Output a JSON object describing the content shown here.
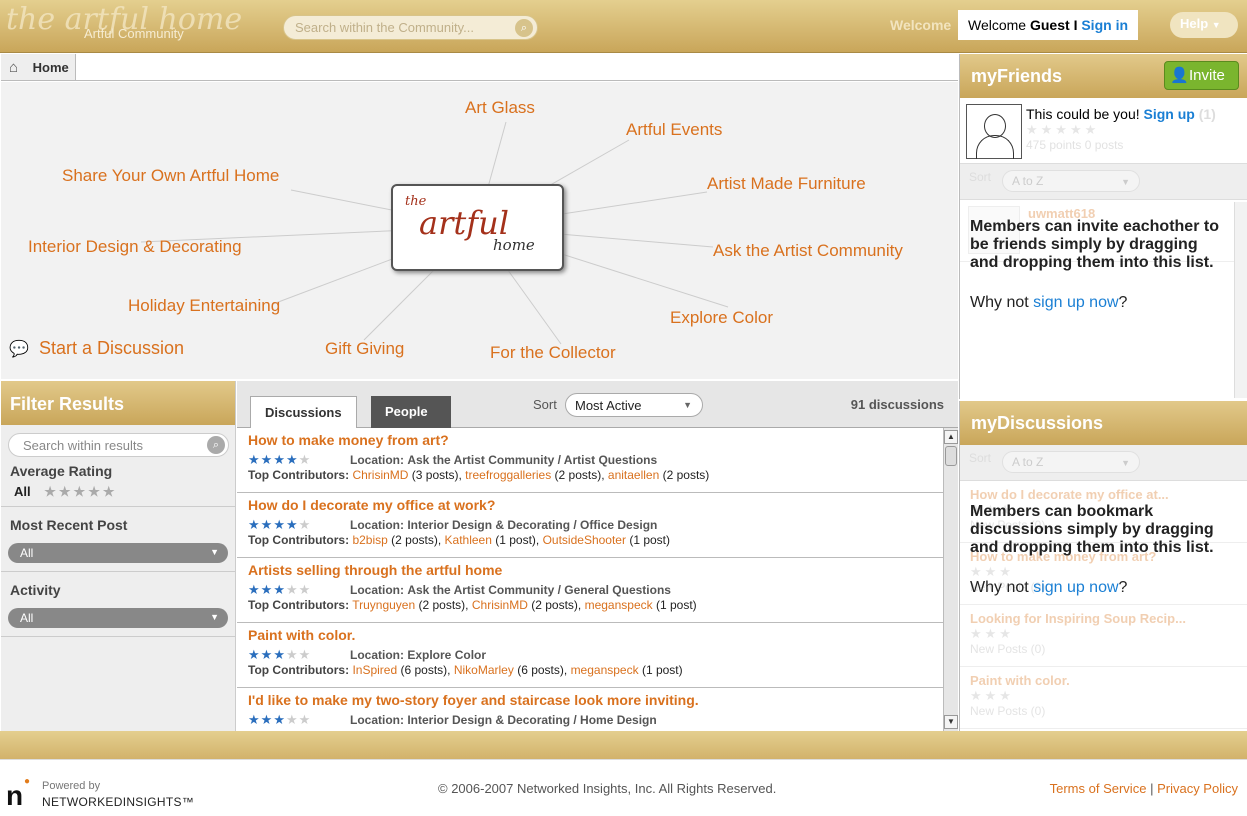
{
  "header": {
    "logo_text": "the artful home",
    "logo_sub": "Artful Community",
    "search_placeholder": "Search within the Community...",
    "welcome_ghost": "Welcome",
    "welcome_prefix": "Welcome",
    "user": "Guest",
    "separator": "I",
    "sign_in": "Sign in",
    "help": "Help"
  },
  "breadcrumb": {
    "home": "Home"
  },
  "map": {
    "center_logo_line1": "the",
    "center_logo_line2": "artful",
    "center_logo_line3": "home",
    "labels": {
      "art_glass": "Art Glass",
      "artful_events": "Artful Events",
      "share": "Share Your Own Artful Home",
      "furniture": "Artist Made Furniture",
      "interior": "Interior Design & Decorating",
      "ask": "Ask the Artist Community",
      "holiday": "Holiday Entertaining",
      "explore": "Explore Color",
      "gift": "Gift Giving",
      "collector": "For the Collector"
    },
    "start_discussion": "Start a Discussion"
  },
  "filter": {
    "title": "Filter Results",
    "search_placeholder": "Search within results",
    "rating_label": "Average Rating",
    "rating_value": "All",
    "recent_label": "Most Recent Post",
    "recent_value": "All",
    "activity_label": "Activity",
    "activity_value": "All"
  },
  "discussions": {
    "tab_discussions": "Discussions",
    "tab_people": "People",
    "sort_label": "Sort",
    "sort_value": "Most Active",
    "count": "91 discussions",
    "location_prefix": "Location:",
    "contrib_prefix": "Top Contributors:",
    "rows": [
      {
        "title": "How to make money from art?",
        "rating": 4,
        "location": "Ask the Artist Community / Artist Questions",
        "c1": "ChrisinMD",
        "p1": "(3 posts),",
        "c2": "treefroggalleries",
        "p2": "(2 posts),",
        "c3": "anitaellen",
        "p3": "(2 posts)"
      },
      {
        "title": "How do I decorate my office at work?",
        "rating": 4,
        "location": "Interior Design & Decorating / Office Design",
        "c1": "b2bisp",
        "p1": "(2 posts),",
        "c2": "Kathleen",
        "p2": "(1 post),",
        "c3": "OutsideShooter",
        "p3": "(1 post)"
      },
      {
        "title": "Artists selling through the artful home",
        "rating": 3,
        "location": "Ask the Artist Community / General Questions",
        "c1": "Truynguyen",
        "p1": "(2 posts),",
        "c2": "ChrisinMD",
        "p2": "(2 posts),",
        "c3": "meganspeck",
        "p3": "(1 post)"
      },
      {
        "title": "Paint  with color.",
        "rating": 3,
        "location": "Explore Color",
        "c1": "InSpired",
        "p1": "(6 posts),",
        "c2": "NikoMarley",
        "p2": "(6 posts),",
        "c3": "meganspeck",
        "p3": "(1 post)"
      },
      {
        "title": "I'd like to make my two-story foyer and staircase look more inviting.",
        "rating": 3,
        "location": "Interior Design & Decorating / Home Design",
        "c1": "",
        "p1": "",
        "c2": "",
        "p2": "",
        "c3": "",
        "p3": ""
      }
    ]
  },
  "friends": {
    "title": "myFriends",
    "invite": "Invite",
    "msg": "This could be you!",
    "signup": "Sign up",
    "count": "(1)",
    "points": "475 points  0 posts",
    "sort_label": "Sort",
    "sort_value": "A to Z",
    "ghost_name": "uwmatt618",
    "overlay_bold": "Members can invite eachother to be friends simply by dragging and dropping them into this list.",
    "overlay_q_prefix": "Why not",
    "overlay_link": "sign up now",
    "overlay_q_suffix": "?"
  },
  "mydiscussions": {
    "title": "myDiscussions",
    "sort_label": "Sort",
    "sort_value": "A to Z",
    "ghost_items": [
      {
        "t": "How do I decorate my office at...",
        "m": "New Posts (0)"
      },
      {
        "t": "How to make money from art?",
        "m": "New Posts (0)"
      },
      {
        "t": "Looking for Inspiring Soup Recip...",
        "m": "New Posts (0)"
      },
      {
        "t": "Paint  with color.",
        "m": "New Posts (0)"
      }
    ],
    "overlay_bold": "Members can bookmark discussions simply by dragging and dropping them into this list.",
    "overlay_q_prefix": "Why not",
    "overlay_link": "sign up now",
    "overlay_q_suffix": "?"
  },
  "footer": {
    "powered": "Powered by",
    "brand": "NETWORKEDINSIGHTS™",
    "logo_letter": "n",
    "copyright": "© 2006-2007 Networked Insights, Inc. All Rights Reserved.",
    "terms": "Terms of Service",
    "sep": "|",
    "privacy": "Privacy Policy"
  },
  "colors": {
    "accent": "#d9711e",
    "link": "#1a7fd4",
    "gold": "#c9a65a",
    "star": "#2a6ebd",
    "invite": "#7ab52e"
  }
}
